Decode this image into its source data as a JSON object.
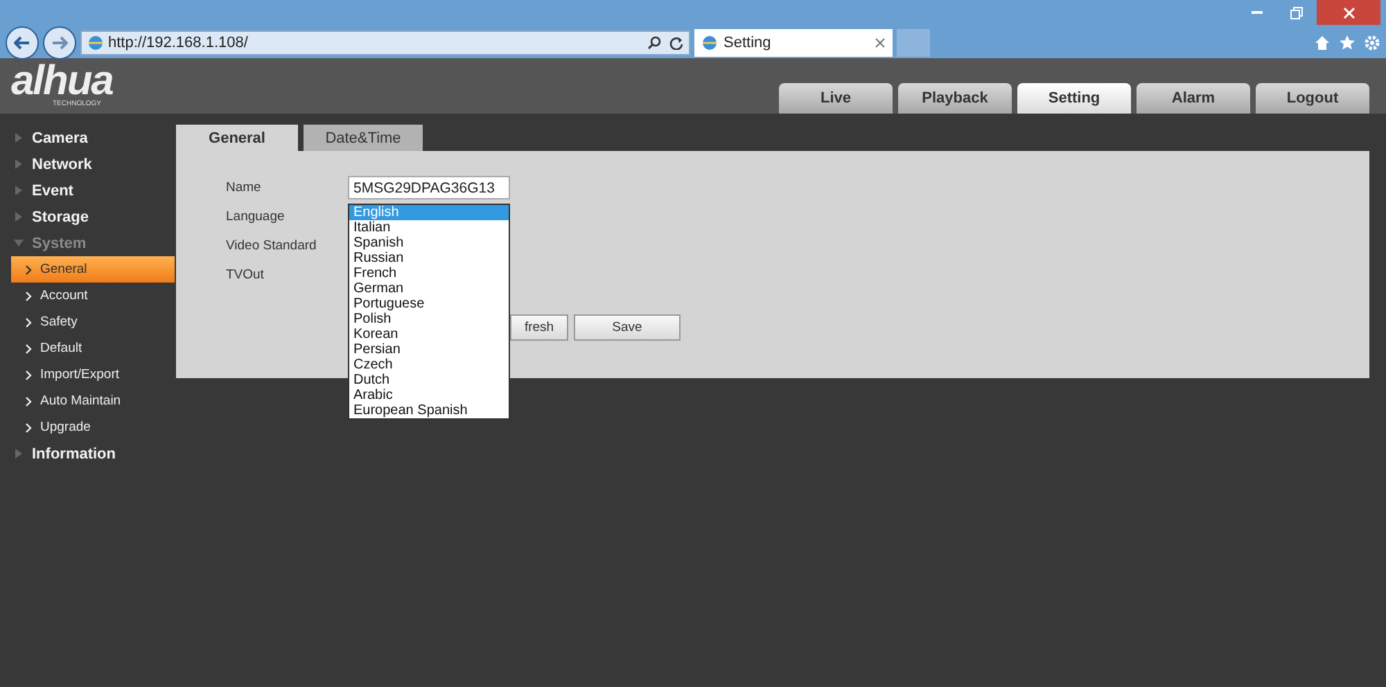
{
  "browser": {
    "url": "http://192.168.1.108/",
    "tab_title": "Setting"
  },
  "header": {
    "logo": "alhua",
    "logo_sub": "TECHNOLOGY"
  },
  "nav": [
    {
      "label": "Live",
      "selected": false
    },
    {
      "label": "Playback",
      "selected": false
    },
    {
      "label": "Setting",
      "selected": true
    },
    {
      "label": "Alarm",
      "selected": false
    },
    {
      "label": "Logout",
      "selected": false
    }
  ],
  "sidebar": [
    {
      "label": "Camera",
      "expanded": false
    },
    {
      "label": "Network",
      "expanded": false
    },
    {
      "label": "Event",
      "expanded": false
    },
    {
      "label": "Storage",
      "expanded": false
    },
    {
      "label": "System",
      "expanded": true,
      "children": [
        {
          "label": "General",
          "selected": true
        },
        {
          "label": "Account",
          "selected": false
        },
        {
          "label": "Safety",
          "selected": false
        },
        {
          "label": "Default",
          "selected": false
        },
        {
          "label": "Import/Export",
          "selected": false
        },
        {
          "label": "Auto Maintain",
          "selected": false
        },
        {
          "label": "Upgrade",
          "selected": false
        }
      ]
    },
    {
      "label": "Information",
      "expanded": false
    }
  ],
  "tabs": [
    {
      "label": "General",
      "selected": true
    },
    {
      "label": "Date&Time",
      "selected": false
    }
  ],
  "form": {
    "labels": [
      "Name",
      "Language",
      "Video Standard",
      "TVOut"
    ],
    "name_value": "5MSG29DPAG36G13"
  },
  "language_list": [
    {
      "label": "English",
      "selected": true
    },
    {
      "label": "Italian",
      "selected": false
    },
    {
      "label": "Spanish",
      "selected": false
    },
    {
      "label": "Russian",
      "selected": false
    },
    {
      "label": "French",
      "selected": false
    },
    {
      "label": "German",
      "selected": false
    },
    {
      "label": "Portuguese",
      "selected": false
    },
    {
      "label": "Polish",
      "selected": false
    },
    {
      "label": "Korean",
      "selected": false
    },
    {
      "label": "Persian",
      "selected": false
    },
    {
      "label": "Czech",
      "selected": false
    },
    {
      "label": "Dutch",
      "selected": false
    },
    {
      "label": "Arabic",
      "selected": false
    },
    {
      "label": "European Spanish",
      "selected": false
    }
  ],
  "buttons": [
    "fresh",
    "Save"
  ]
}
